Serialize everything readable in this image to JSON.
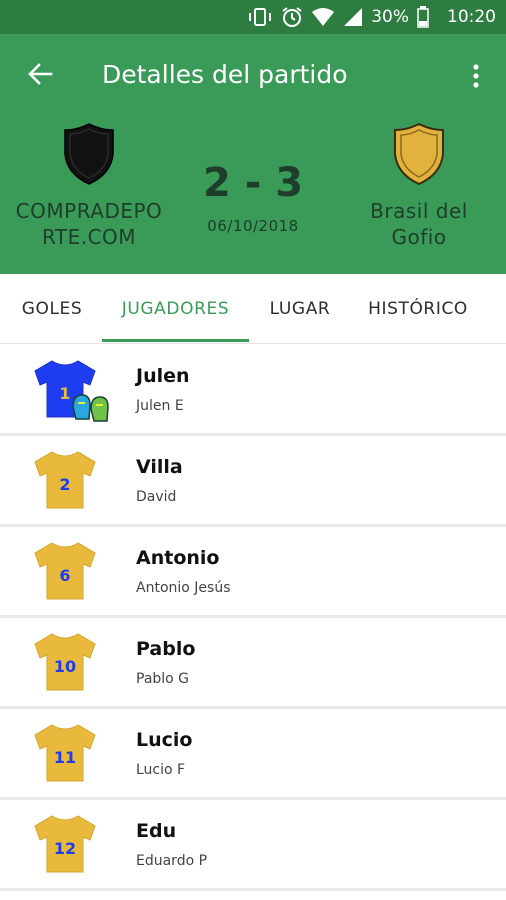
{
  "status_bar": {
    "battery": "30%",
    "time": "10:20"
  },
  "header": {
    "title": "Detalles del partido"
  },
  "match": {
    "home_team": "COMPRADEPORTE.COM",
    "away_team": "Brasil del Gofio",
    "score": "2 - 3",
    "date": "06/10/2018"
  },
  "colors": {
    "header_green": "#3a9b59",
    "home_crest": "#111111",
    "away_crest": "#e3b23c",
    "shirt_gold": "#e8b93a",
    "shirt_blue": "#1f3df0",
    "shirt_number": "#1f3df0"
  },
  "tabs": [
    {
      "label": "GOLES"
    },
    {
      "label": "JUGADORES",
      "active": true
    },
    {
      "label": "LUGAR"
    },
    {
      "label": "HISTÓRICO"
    }
  ],
  "players": [
    {
      "number": "1",
      "name": "Julen",
      "alias": "Julen E",
      "goalkeeper": true
    },
    {
      "number": "2",
      "name": "Villa",
      "alias": "David"
    },
    {
      "number": "6",
      "name": "Antonio",
      "alias": "Antonio Jesús"
    },
    {
      "number": "10",
      "name": "Pablo",
      "alias": "Pablo G"
    },
    {
      "number": "11",
      "name": "Lucio",
      "alias": "Lucio F"
    },
    {
      "number": "12",
      "name": "Edu",
      "alias": "Eduardo P"
    }
  ]
}
